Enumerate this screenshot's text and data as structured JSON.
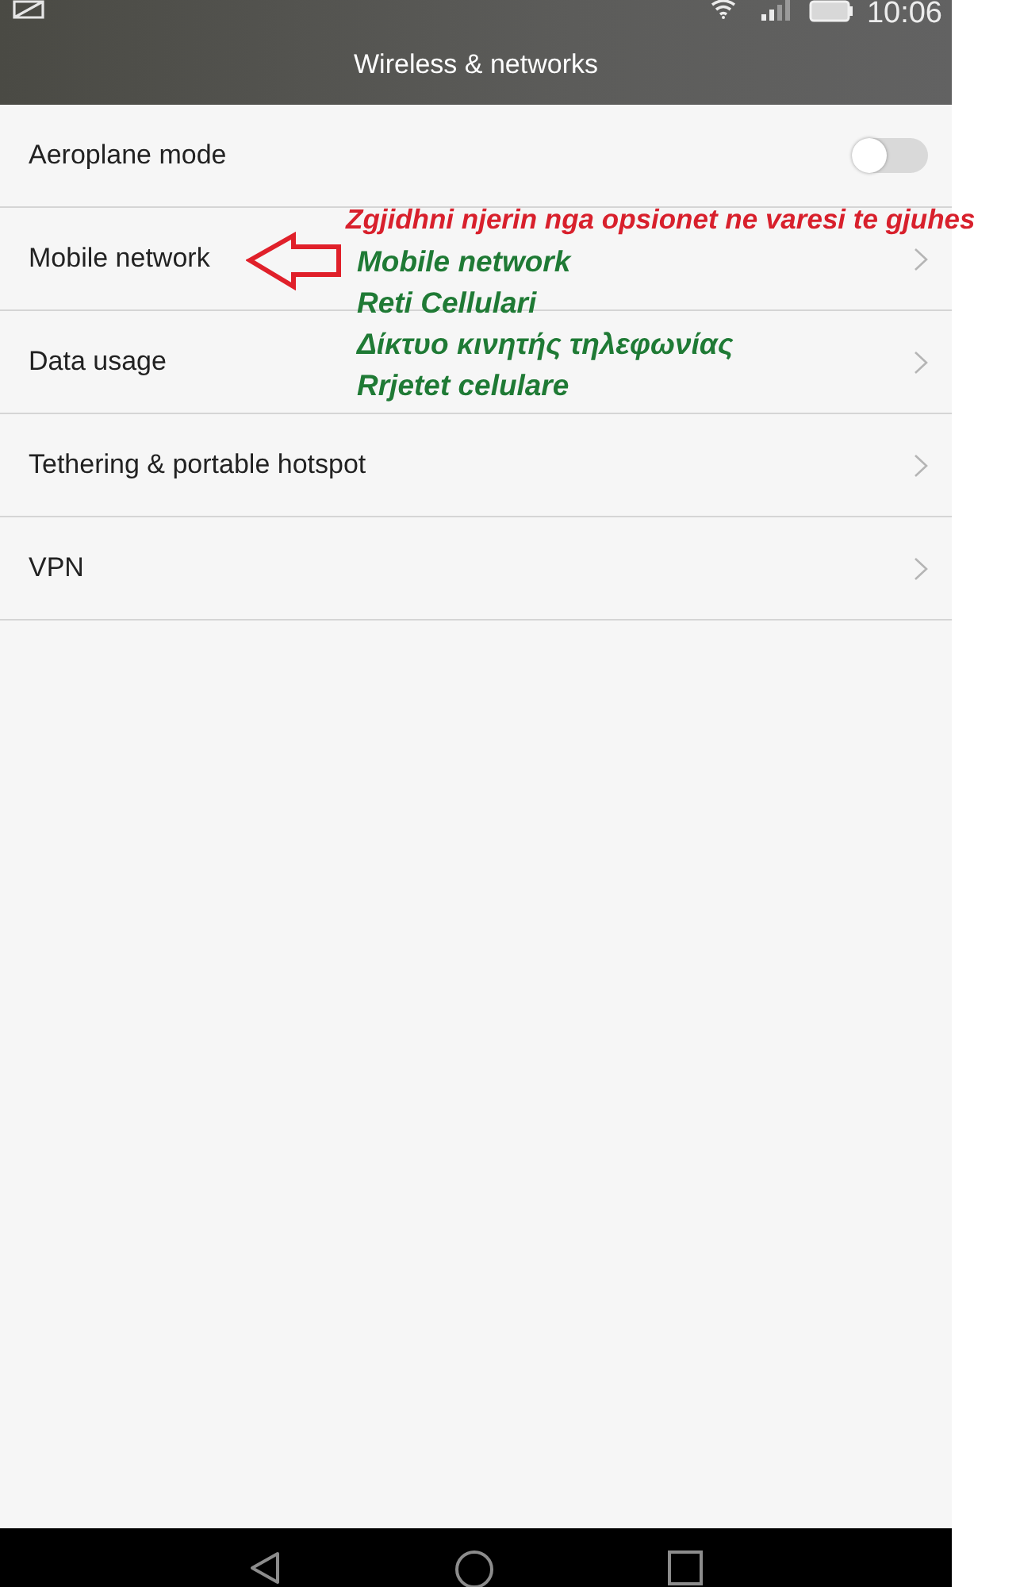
{
  "status_bar": {
    "time": "10:06"
  },
  "header": {
    "title": "Wireless & networks"
  },
  "settings": [
    {
      "kind": "toggle",
      "label": "Aeroplane mode",
      "on": false
    },
    {
      "kind": "link",
      "label": "Mobile network"
    },
    {
      "kind": "link",
      "label": "Data usage"
    },
    {
      "kind": "link",
      "label": "Tethering & portable hotspot"
    },
    {
      "kind": "link",
      "label": "VPN"
    }
  ],
  "annotation": {
    "note": "Zgjidhni njerin nga opsionet ne varesi te gjuhes",
    "translations": [
      "Mobile network",
      "Reti Cellulari",
      "Δίκτυο κινητής τηλεφωνίας",
      "Rrjetet celulare"
    ]
  }
}
